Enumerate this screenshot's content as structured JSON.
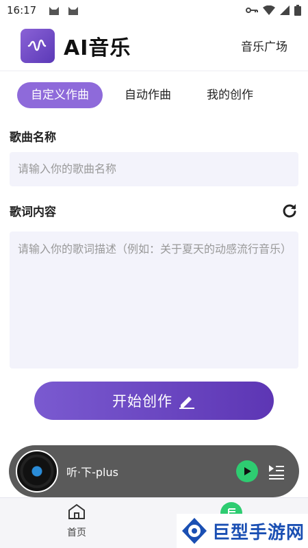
{
  "status_bar": {
    "time": "16:17"
  },
  "header": {
    "app_title": "AI音乐",
    "plaza_link": "音乐广场"
  },
  "tabs": [
    {
      "label": "自定义作曲",
      "active": true
    },
    {
      "label": "自动作曲",
      "active": false
    },
    {
      "label": "我的创作",
      "active": false
    }
  ],
  "form": {
    "song_name_label": "歌曲名称",
    "song_name_placeholder": "请输入你的歌曲名称",
    "lyrics_label": "歌词内容",
    "lyrics_placeholder": "请输入你的歌词描述（例如：关于夏天的动感流行音乐）",
    "create_button": "开始创作"
  },
  "player": {
    "track_title": "听·下-plus"
  },
  "bottom_nav": {
    "home_label": "首页"
  },
  "watermark": {
    "text": "巨型手游网"
  },
  "colors": {
    "accent": "#8e6ada",
    "button_gradient_start": "#7a5ad0",
    "button_gradient_end": "#5d36b4",
    "play_green": "#2ecc71"
  }
}
